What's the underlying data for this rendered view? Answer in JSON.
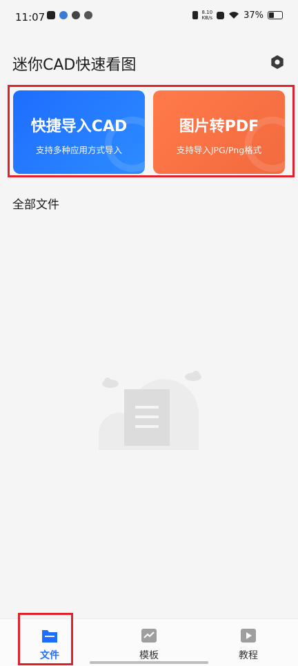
{
  "status_bar": {
    "time": "11:07",
    "net_speed_value": "8.10",
    "net_speed_unit": "KB/s",
    "battery": "37%"
  },
  "header": {
    "title": "迷你CAD快速看图",
    "settings_icon": "gear-icon"
  },
  "banners": [
    {
      "title": "快捷导入CAD",
      "subtitle": "支持多种应用方式导入"
    },
    {
      "title": "图片转PDF",
      "subtitle": "支持导入JPG/Png格式"
    }
  ],
  "section": {
    "title": "全部文件"
  },
  "colors": {
    "accent": "#1e6dff",
    "pdf_orange": "#f26a3f",
    "highlight_red": "#e0202a"
  },
  "bottom_nav": [
    {
      "label": "文件",
      "icon": "folder-icon",
      "active": true
    },
    {
      "label": "模板",
      "icon": "chart-icon",
      "active": false
    },
    {
      "label": "教程",
      "icon": "play-icon",
      "active": false
    }
  ]
}
